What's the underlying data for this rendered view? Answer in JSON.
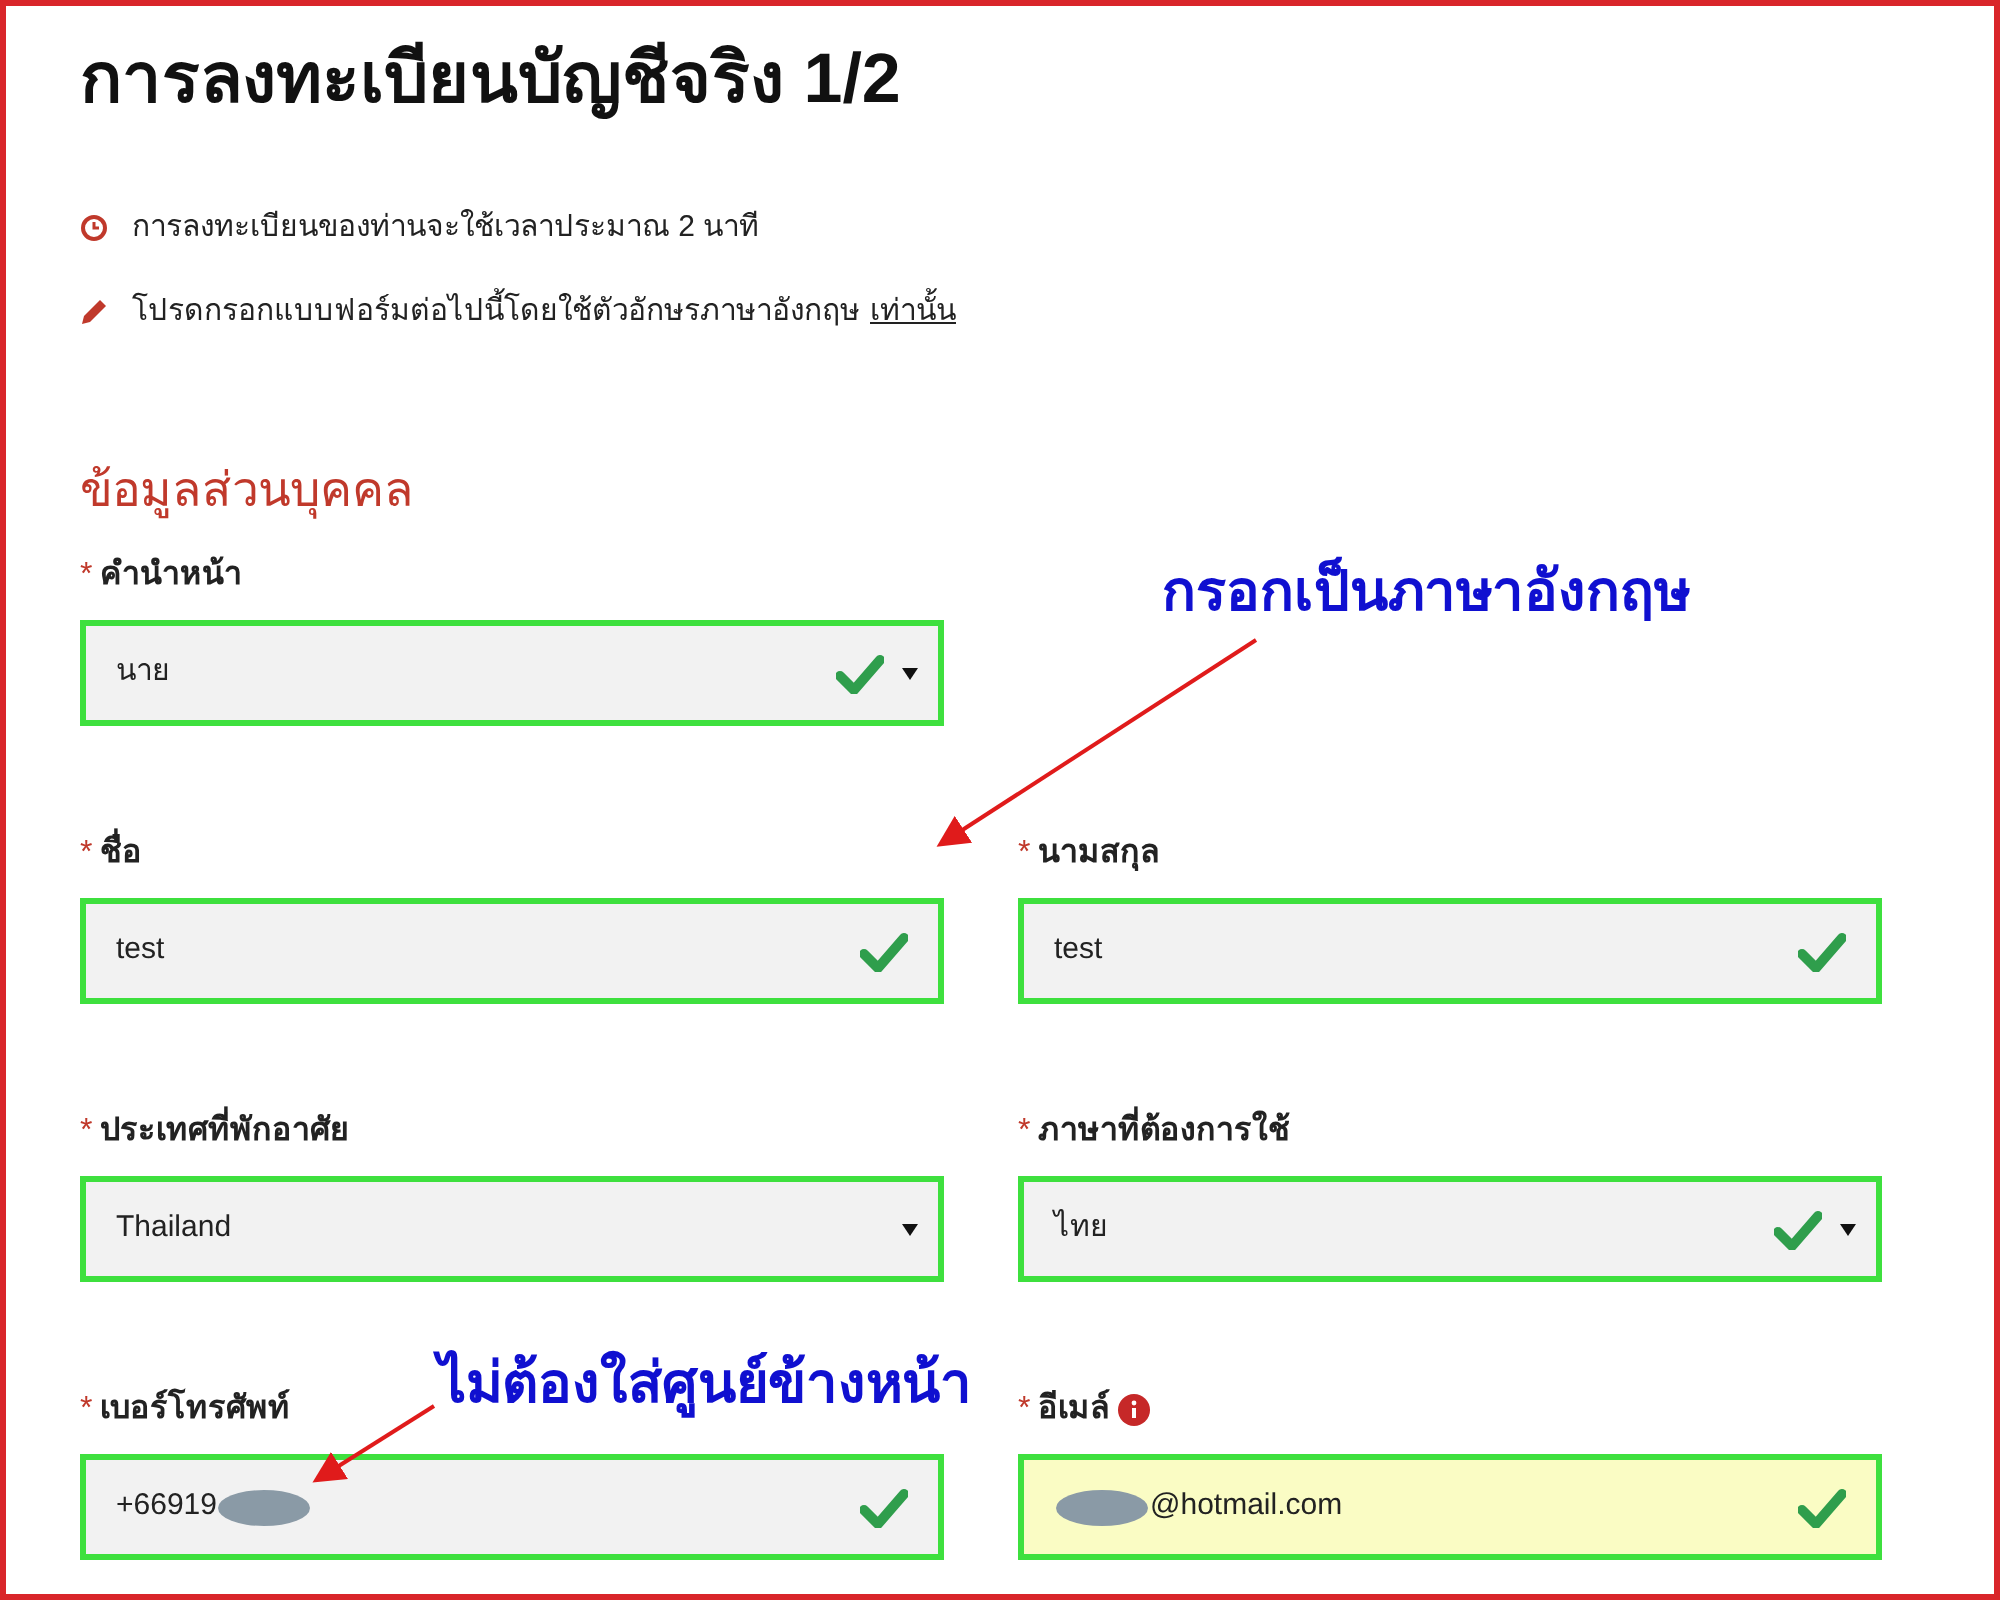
{
  "title": "การลงทะเบียนบัญชีจริง 1/2",
  "notes": [
    {
      "kind": "clock",
      "text": "การลงทะเบียนของท่านจะใช้เวลาประมาณ 2 นาที"
    },
    {
      "kind": "pencil",
      "text": "โปรดกรอกแบบฟอร์มต่อไปนี้โดยใช้ตัวอักษรภาษาอังกฤษ",
      "link": "เท่านั้น"
    }
  ],
  "section_title": "ข้อมูลส่วนบุคคล",
  "rows": [
    [
      {
        "label": "คำนำหน้า",
        "required": "*",
        "kind": "select",
        "value": "นาย",
        "valid": true,
        "info": false,
        "autofilled": false
      }
    ],
    [
      {
        "label": "ชื่อ",
        "required": "*",
        "kind": "input",
        "value": "test",
        "valid": true,
        "info": false,
        "autofilled": false
      },
      {
        "label": "นามสกุล",
        "required": "*",
        "kind": "input",
        "value": "test",
        "valid": true,
        "info": false,
        "autofilled": false
      }
    ],
    [
      {
        "label": "ประเทศที่พักอาศัย",
        "required": "*",
        "kind": "select",
        "value": "Thailand",
        "valid": false,
        "info": false,
        "autofilled": false
      },
      {
        "label": "ภาษาที่ต้องการใช้",
        "required": "*",
        "kind": "select",
        "value": "ไทย",
        "valid": true,
        "info": false,
        "autofilled": false
      }
    ],
    [
      {
        "label": "เบอร์โทรศัพท์",
        "required": "*",
        "kind": "input",
        "value_parts": [
          {
            "kind": "text",
            "text": "+66919"
          },
          {
            "kind": "blur"
          }
        ],
        "valid": true,
        "info": false,
        "autofilled": false
      },
      {
        "label": "อีเมล์",
        "required": "*",
        "kind": "input",
        "value_parts": [
          {
            "kind": "blur"
          },
          {
            "kind": "text",
            "text": "@hotmail.com"
          }
        ],
        "valid": true,
        "info": true,
        "autofilled": true
      }
    ]
  ],
  "annotations": [
    {
      "text": "กรอกเป็นภาษาอังกฤษ"
    },
    {
      "text": "ไม่ต้องใส่ศูนย์ข้างหน้า"
    }
  ]
}
